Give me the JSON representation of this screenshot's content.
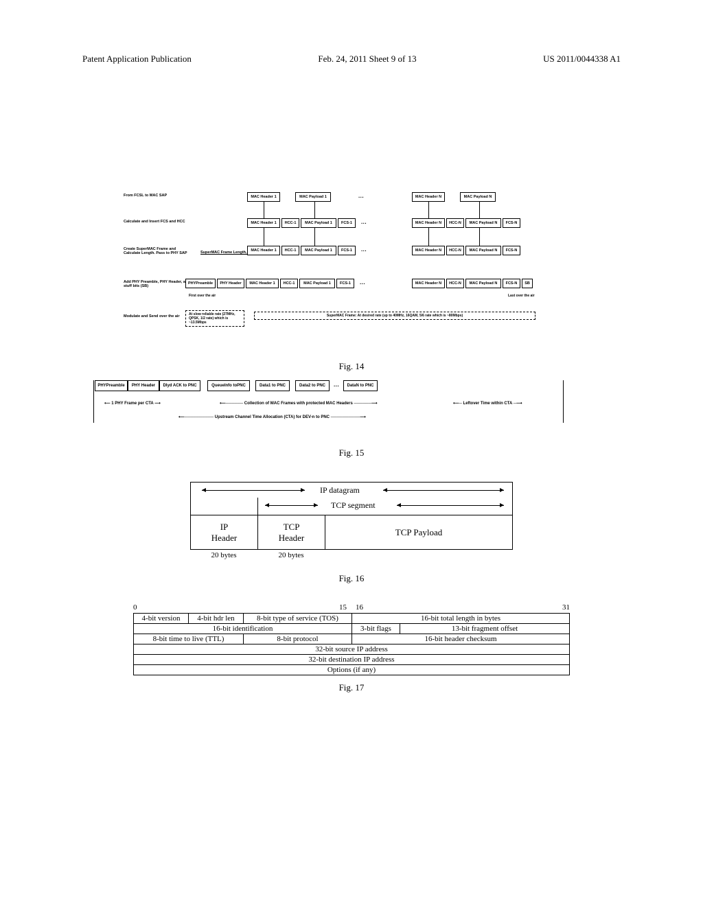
{
  "header": {
    "left": "Patent Application Publication",
    "center": "Feb. 24, 2011  Sheet 9 of 13",
    "right": "US 2011/0044338 A1"
  },
  "fig14": {
    "rows": {
      "r1": {
        "label": "From FCSL to MAC SAP"
      },
      "r2": {
        "label": "Calculate and Insert FCS and HCC"
      },
      "r3": {
        "label": "Create SuperMAC Frame and Calculate Length.  Pass to PHY SAP",
        "underline": "SuperMAC Frame Length, etc"
      },
      "r4": {
        "label": "Add PHY Preamble, PHY Header, and stuff bits (SB)"
      },
      "r5": {
        "label": "Modulate and Send over the air"
      }
    },
    "blocks": {
      "mac_header_1": "MAC Header 1",
      "mac_payload_1": "MAC Payload 1",
      "mac_header_n": "MAC Header N",
      "mac_payload_n": "MAC Payload N",
      "hcc_1": "HCC-1",
      "fcs_1": "FCS-1",
      "hcc_n": "HCC-N",
      "fcs_n": "FCS-N",
      "phy_preamble": "PHYPreamble",
      "phy_header": "PHY Header",
      "sb": "SB"
    },
    "notes": {
      "first_over_air": "First over the air",
      "last_over_air": "Last over the air",
      "slow_rate": "At slow reliable rate (27MHz, QPSK, 1/2 rate) which is ~13.5Mbps",
      "super_rate": "SuperMAC Frame: At desired rate (up to 40MHz, 16QAM, 5/6 rate which is ~80Mbps)"
    },
    "caption": "Fig. 14"
  },
  "fig15": {
    "blocks": {
      "phy_preamble": "PHYPreamble",
      "phy_header": "PHY Header",
      "dlyd_ack": "Dlyd ACK to PNC",
      "queueinfo": "QueueInfo toPNC",
      "data1": "Data1 to PNC",
      "data2": "Data2 to PNC",
      "datan": "DataN to PNC"
    },
    "labels": {
      "one_phy": "1 PHY Frame per CTA",
      "collection": "Collection of MAC Frames with protected MAC Headers",
      "leftover": "Leftover Time within CTA",
      "upstream": "Upstream Channel Time Allocation (CTA) for DEV-n to PNC"
    },
    "caption": "Fig. 15"
  },
  "fig16": {
    "bracket_top": "IP datagram",
    "bracket_mid": "TCP segment",
    "cells": {
      "ip_header": "IP\nHeader",
      "tcp_header": "TCP\nHeader",
      "tcp_payload": "TCP Payload"
    },
    "bytes": {
      "b1": "20 bytes",
      "b2": "20 bytes"
    },
    "caption": "Fig. 16"
  },
  "fig17": {
    "bits": {
      "b0": "0",
      "b15": "15",
      "b16": "16",
      "b31": "31"
    },
    "row1": {
      "c1": "4-bit version",
      "c2": "4-bit hdr len",
      "c3": "8-bit type of service (TOS)",
      "c4": "16-bit total length in bytes"
    },
    "row2": {
      "c1": "16-bit identification",
      "c2": "3-bit flags",
      "c3": "13-bit fragment offset"
    },
    "row3": {
      "c1": "8-bit time to live (TTL)",
      "c2": "8-bit protocol",
      "c3": "16-bit header checksum"
    },
    "row4": {
      "c1": "32-bit source IP address"
    },
    "row5": {
      "c1": "32-bit destination IP address"
    },
    "row6": {
      "c1": "Options (if any)"
    },
    "caption": "Fig. 17"
  }
}
